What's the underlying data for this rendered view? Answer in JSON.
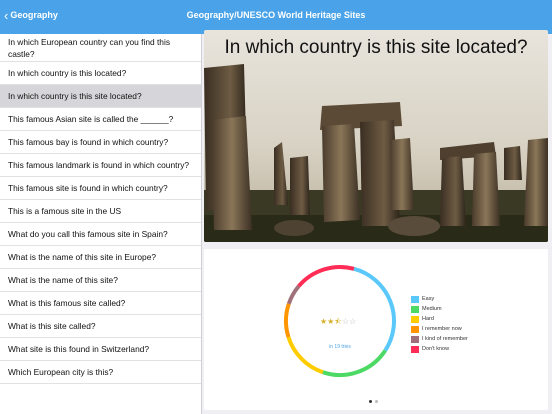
{
  "navbar": {
    "back_label": "Geography",
    "title": "Geography/UNESCO World Heritage Sites"
  },
  "questions": [
    {
      "label": "In which European country can you find this castle?",
      "selected": false
    },
    {
      "label": "In which country is this located?",
      "selected": false
    },
    {
      "label": "In which country is this site located?",
      "selected": true
    },
    {
      "label": "This famous Asian site is called the ______?",
      "selected": false
    },
    {
      "label": "This famous bay is found in which country?",
      "selected": false
    },
    {
      "label": "This famous landmark is found in which country?",
      "selected": false
    },
    {
      "label": "This famous site is found in which country?",
      "selected": false
    },
    {
      "label": "This is a famous site in the US",
      "selected": false
    },
    {
      "label": "What do you call this famous site in Spain?",
      "selected": false
    },
    {
      "label": "What is the name of this site in Europe?",
      "selected": false
    },
    {
      "label": "What is the name of this site?",
      "selected": false
    },
    {
      "label": "What is this famous site called?",
      "selected": false
    },
    {
      "label": "What is this site called?",
      "selected": false
    },
    {
      "label": "What site is this found in Switzerland?",
      "selected": false
    },
    {
      "label": "Which European city is this?",
      "selected": false
    }
  ],
  "question_card": {
    "text": "In which country is this site located?"
  },
  "stats": {
    "rating": 2.5,
    "rating_max": 5,
    "tries_text": "in 19 tries",
    "chart_data": {
      "type": "pie",
      "categories": [
        "Easy",
        "Medium",
        "Hard",
        "I remember now",
        "I kind of remember",
        "Don't know"
      ],
      "values": [
        30,
        21,
        15,
        10,
        6,
        18
      ],
      "colors": [
        "#5ac8fa",
        "#4cd964",
        "#ffcc00",
        "#ff9500",
        "#a0707a",
        "#ff2d55"
      ]
    }
  },
  "page_indicator": {
    "count": 2,
    "active": 0
  }
}
